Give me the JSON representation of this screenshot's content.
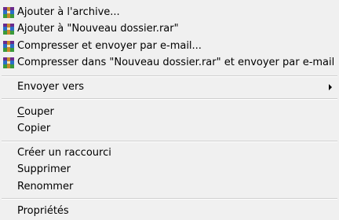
{
  "menu": {
    "top_partial": "",
    "items": [
      {
        "label": "Ajouter à l'archive...",
        "icon": "winrar-archive-icon"
      },
      {
        "label": "Ajouter à \"Nouveau dossier.rar\"",
        "icon": "winrar-archive-icon"
      },
      {
        "label": "Compresser et envoyer par e-mail...",
        "icon": "winrar-archive-icon"
      },
      {
        "label": "Compresser dans \"Nouveau dossier.rar\" et envoyer par e-mail",
        "icon": "winrar-archive-icon"
      },
      {
        "label": "Envoyer vers",
        "submenu": true
      },
      {
        "label_first": "C",
        "label_rest": "ouper"
      },
      {
        "label": "Copier"
      },
      {
        "label": "Créer un raccourci"
      },
      {
        "label": "Supprimer"
      },
      {
        "label": "Renommer"
      },
      {
        "label": "Propriétés"
      }
    ]
  }
}
